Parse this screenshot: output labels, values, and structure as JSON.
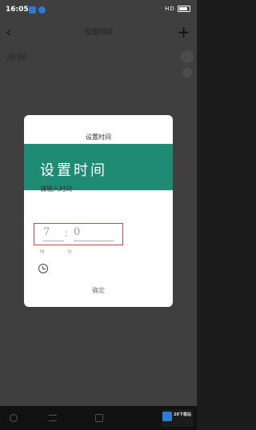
{
  "status_bar": {
    "time": "16:05",
    "right_text": "HD"
  },
  "header": {
    "title": "设置时间",
    "back_icon": "back-chevron-icon",
    "add_icon": "plus-icon"
  },
  "page": {
    "subtitle": "闹钟"
  },
  "dialog": {
    "title": "设置时间",
    "banner": "设置时间",
    "input_label": "请输入时间",
    "hour_value": "7",
    "minute_value": "0",
    "separator": ":",
    "hint_hour": "时",
    "hint_minute": "分",
    "clock_icon": "clock-icon",
    "ok_label": "确定"
  },
  "colors": {
    "accent": "#1f8b75",
    "highlight": "#c84848"
  },
  "watermark": {
    "text": "20下载站"
  }
}
